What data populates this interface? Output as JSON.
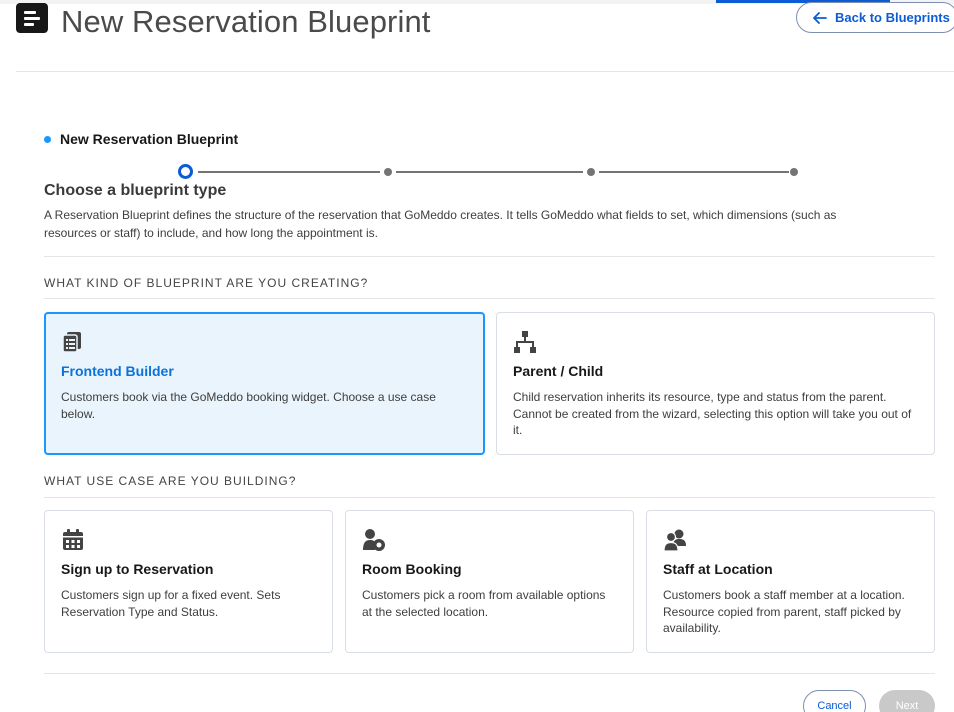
{
  "header": {
    "title": "New Reservation Blueprint",
    "back_label": "Back to Blueprints"
  },
  "wizard": {
    "step_title": "New Reservation Blueprint",
    "steps_total": 4,
    "current_step": 1
  },
  "intro": {
    "title": "Choose a blueprint type",
    "description": "A Reservation Blueprint defines the structure of the reservation that GoMeddo creates. It tells GoMeddo what fields to set, which dimensions (such as resources or staff) to include, and how long the appointment is."
  },
  "kind": {
    "label": "WHAT KIND OF BLUEPRINT ARE YOU CREATING?",
    "options": [
      {
        "icon": "document-list-icon",
        "title": "Frontend Builder",
        "description": "Customers book via the GoMeddo booking widget. Choose a use case below.",
        "selected": true
      },
      {
        "icon": "hierarchy-icon",
        "title": "Parent / Child",
        "description": "Child reservation inherits its resource, type and status from the parent. Cannot be created from the wizard, selecting this option will take you out of it.",
        "selected": false
      }
    ]
  },
  "use_case": {
    "label": "WHAT USE CASE ARE YOU BUILDING?",
    "options": [
      {
        "icon": "calendar-icon",
        "title": "Sign up to Reservation",
        "description": "Customers sign up for a fixed event. Sets Reservation Type and Status."
      },
      {
        "icon": "person-location-icon",
        "title": "Room Booking",
        "description": "Customers pick a room from available options at the selected location."
      },
      {
        "icon": "people-icon",
        "title": "Staff at Location",
        "description": "Customers book a staff member at a location. Resource copied from parent, staff picked by availability."
      }
    ]
  },
  "footer": {
    "cancel_label": "Cancel",
    "next_label": "Next"
  },
  "colors": {
    "brand": "#0b5cd5",
    "accent": "#1b96ff",
    "selected_bg": "#eaf4fc",
    "disabled": "#c9c9c9"
  }
}
